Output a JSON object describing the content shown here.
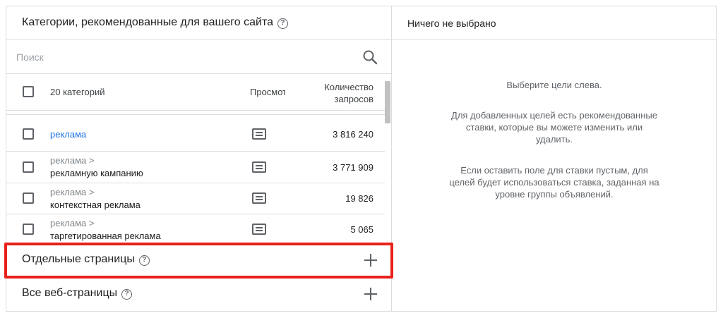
{
  "left_panel": {
    "title": "Категории, рекомендованные для вашего сайта",
    "search": {
      "placeholder": "Поиск",
      "value": ""
    },
    "table": {
      "count_label": "20 категорий",
      "col_preview": "Просмотр",
      "col_queries_line1": "Количество",
      "col_queries_line2": "запросов",
      "rows": [
        {
          "parent": "",
          "name": "реклама",
          "value": "3 816 240"
        },
        {
          "parent": "реклама >",
          "name": "рекламную кампанию",
          "value": "3 771 909"
        },
        {
          "parent": "реклама >",
          "name": "контекстная реклама",
          "value": "19 826"
        },
        {
          "parent": "реклама >",
          "name": "таргетированная реклама",
          "value": "5 065"
        }
      ]
    },
    "sections": [
      {
        "title": "Отдельные страницы"
      },
      {
        "title": "Все веб-страницы"
      }
    ]
  },
  "right_panel": {
    "title": "Ничего не выбрано",
    "hint1": "Выберите цели слева.",
    "hint2_l1": "Для добавленных целей есть рекомендованные",
    "hint2_l2": "ставки, которые вы можете изменить или",
    "hint2_l3": "удалить.",
    "hint3_l1": "Если оставить поле для ставки пустым, для",
    "hint3_l2": "целей будет использоваться ставка, заданная на",
    "hint3_l3": "уровне группы объявлений."
  },
  "colors": {
    "highlight": "#e8211a",
    "link": "#1a73e8",
    "border": "#dadce0"
  },
  "icons": [
    "help-icon",
    "search-icon",
    "preview-icon",
    "plus-icon",
    "checkbox"
  ]
}
